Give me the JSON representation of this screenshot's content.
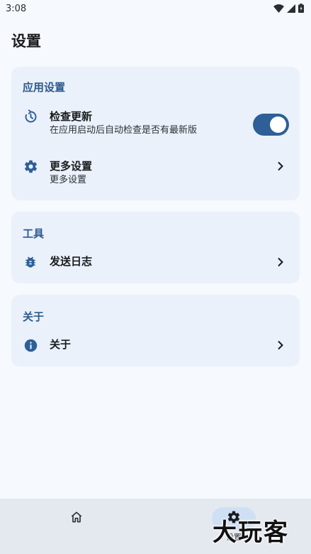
{
  "status_bar": {
    "time": "3:08"
  },
  "page_title": "设置",
  "sections": {
    "app": {
      "header": "应用设置",
      "check_update": {
        "title": "检查更新",
        "subtitle": "在应用启动后自动检查是否有最新版",
        "toggle_on": true
      },
      "more_settings": {
        "title": "更多设置",
        "subtitle": "更多设置"
      }
    },
    "tools": {
      "header": "工具",
      "send_log": {
        "title": "发送日志"
      }
    },
    "about": {
      "header": "关于",
      "about_item": {
        "title": "关于"
      }
    }
  },
  "bottom_nav": {
    "home": {
      "icon": "home-icon",
      "label": ""
    },
    "settings": {
      "icon": "gear-icon",
      "label": "设置",
      "active": true
    }
  },
  "watermark": "大玩客",
  "colors": {
    "accent": "#2e5f97",
    "header_text": "#2b5a8e",
    "card_bg": "#eaf1fb",
    "page_bg": "#f6f9fe",
    "nav_bg": "#e4e9f0"
  }
}
